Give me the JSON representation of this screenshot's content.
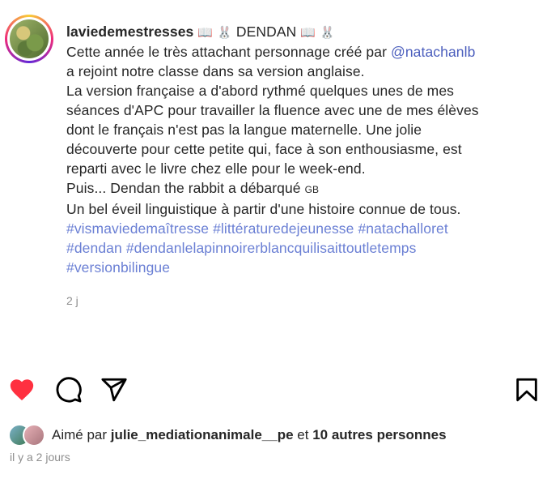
{
  "post": {
    "username": "laviedemestresses",
    "header_extra": "DENDAN",
    "lines": {
      "l1_pre": "Cette année le très attachant personnage créé par ",
      "l1_mention": "@natachanlb",
      "l2": "a rejoint notre classe dans sa version anglaise.",
      "l3": "La version française a d'abord rythmé quelques unes de mes",
      "l4": "séances d'APC pour travailler la fluence avec une de mes élèves",
      "l5": "dont le français n'est pas la langue maternelle. Une jolie",
      "l6": "découverte pour cette petite qui, face à son enthousiasme, est",
      "l7": "reparti avec le livre chez elle pour le week-end.",
      "l8_pre": "Puis... Dendan the rabbit a débarqué ",
      "l8_flag": "GB",
      "l9": "Un bel éveil linguistique à partir d'une histoire connue de tous."
    },
    "hashtags": {
      "row1": [
        "#vismaviedemaîtresse",
        "#littératuredejeunesse",
        "#natachalloret"
      ],
      "row2": [
        "#dendan",
        "#dendanlelapinnoirerblancquilisaittoutletemps"
      ],
      "row3": [
        "#versionbilingue"
      ]
    },
    "time_ago": "2 j"
  },
  "icons": {
    "book": "book-emoji-icon",
    "rabbit": "rabbit-emoji-icon",
    "like": "heart-icon",
    "comment": "comment-icon",
    "share": "paper-plane-icon",
    "save": "bookmark-icon"
  },
  "colors": {
    "like_red": "#ff3040",
    "link": "#4b5ebd",
    "hashtag": "#6a7fd4",
    "muted": "#8e8e8e"
  },
  "likes": {
    "prefix": "Aimé par ",
    "user": "julie_mediationanimale__pe",
    "middle": " et ",
    "others": "10 autres personnes"
  },
  "date": "il y a 2 jours"
}
